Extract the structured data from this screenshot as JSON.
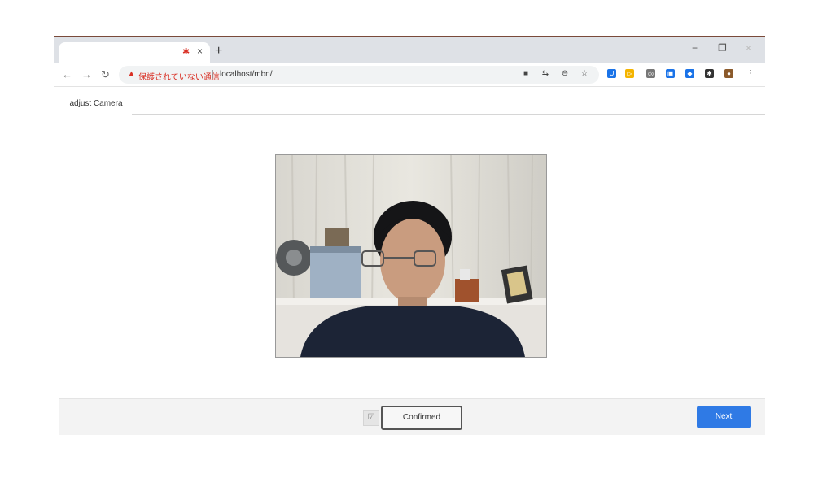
{
  "browser": {
    "tab_icon": "close-icon",
    "tab_close": "×",
    "new_tab": "+",
    "window_controls": [
      "−",
      "❐",
      "×"
    ],
    "nav": {
      "back": "←",
      "forward": "→",
      "reload": "↻"
    },
    "address": {
      "warning_icon": "▲",
      "warning_text": "保護されていない通信",
      "separator": "|",
      "url": "localhost/mbn/"
    },
    "toolbar_icons": [
      "■",
      "⇆",
      "⊖",
      "☆"
    ],
    "extensions": [
      {
        "icon": "U",
        "color": "#1a73e8"
      },
      {
        "icon": "▷",
        "color": "#f4b400"
      },
      {
        "icon": "◎",
        "color": "#777777"
      },
      {
        "icon": "▣",
        "color": "#1a73e8"
      },
      {
        "icon": "◆",
        "color": "#1a73e8"
      },
      {
        "icon": "✱",
        "color": "#333333"
      },
      {
        "icon": "●",
        "color": "#8b5a2b"
      }
    ],
    "menu": "⋮"
  },
  "page": {
    "tab_label": "adjust Camera",
    "checkbox_mark": "☑",
    "confirmed_label": "Confirmed",
    "next_label": "Next"
  },
  "colors": {
    "accent": "#2f7ae5",
    "warning": "#d93025"
  }
}
